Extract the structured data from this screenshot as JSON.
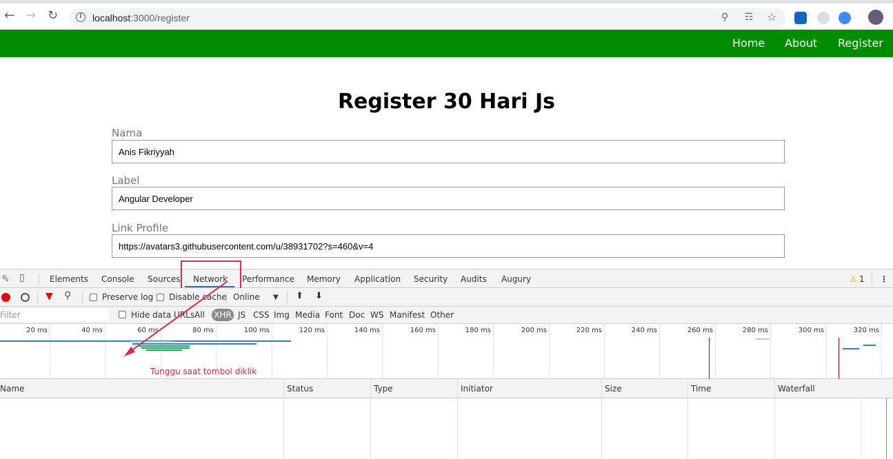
{
  "browser": {
    "url_host": "localhost",
    "url_path": ":3000/register",
    "icons": [
      "back-icon",
      "forward-icon",
      "reload-icon",
      "info-icon",
      "key-icon",
      "translate-icon",
      "star-icon"
    ]
  },
  "navbar": {
    "bg_color": "#008c00",
    "links": [
      "Home",
      "About",
      "Register"
    ]
  },
  "form": {
    "title": "Register 30 Hari Js",
    "fields": [
      {
        "label": "Nama",
        "value": "Anis Fikriyyah"
      },
      {
        "label": "Label",
        "value": "Angular Developer"
      },
      {
        "label": "Link Profile",
        "value": "https://avatars3.githubusercontent.com/u/38931702?s=460&v=4"
      }
    ]
  },
  "devtools": {
    "tabs": [
      "Elements",
      "Console",
      "Sources",
      "Network",
      "Performance",
      "Memory",
      "Application",
      "Security",
      "Audits",
      "Augury"
    ],
    "active_tab": "Network",
    "warning_count": "1",
    "toolbar": {
      "preserve_log": "Preserve log",
      "disable_cache": "Disable cache",
      "throttling": "Online"
    },
    "filter": {
      "placeholder": "Filter",
      "hide_data_urls": "Hide data URLs",
      "types": [
        "All",
        "XHR",
        "JS",
        "CSS",
        "Img",
        "Media",
        "Font",
        "Doc",
        "WS",
        "Manifest",
        "Other"
      ],
      "active_type": "XHR"
    },
    "timeline_ticks": [
      "20 ms",
      "40 ms",
      "60 ms",
      "80 ms",
      "100 ms",
      "120 ms",
      "140 ms",
      "160 ms",
      "180 ms",
      "200 ms",
      "220 ms",
      "240 ms",
      "260 ms",
      "280 ms",
      "300 ms",
      "320 ms"
    ],
    "annotation": "Tunggu saat tombol diklik",
    "columns": [
      "Name",
      "Status",
      "Type",
      "Initiator",
      "Size",
      "Time",
      "Waterfall"
    ],
    "highlight_color": "#e3264b"
  }
}
